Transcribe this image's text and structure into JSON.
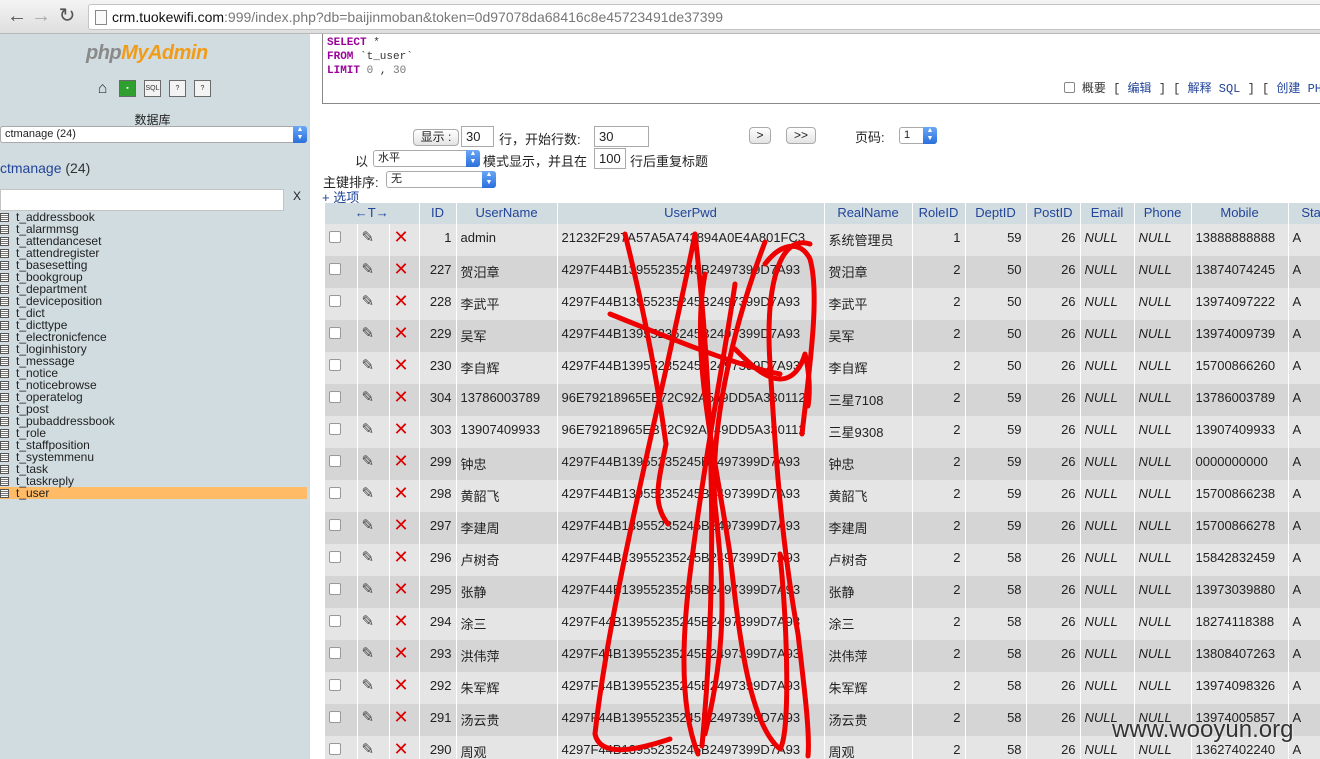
{
  "browser": {
    "url_host": "crm.tuokewifi.com",
    "url_rest": ":999/index.php?db=baijinmoban&token=0d97078da68416c8e45723491de37399"
  },
  "sidebar": {
    "logo_php": "php",
    "logo_myadmin": "MyAdmin",
    "db_label": "数据库",
    "db_select": "ctmanage (24)",
    "db_current": "ctmanage",
    "db_count": "(24)",
    "filter_clear": "X",
    "tables": [
      {
        "name": "t_addressbook"
      },
      {
        "name": "t_alarmmsg"
      },
      {
        "name": "t_attendanceset"
      },
      {
        "name": "t_attendregister"
      },
      {
        "name": "t_basesetting"
      },
      {
        "name": "t_bookgroup"
      },
      {
        "name": "t_department"
      },
      {
        "name": "t_deviceposition"
      },
      {
        "name": "t_dict"
      },
      {
        "name": "t_dicttype"
      },
      {
        "name": "t_electronicfence"
      },
      {
        "name": "t_loginhistory"
      },
      {
        "name": "t_message"
      },
      {
        "name": "t_notice"
      },
      {
        "name": "t_noticebrowse"
      },
      {
        "name": "t_operatelog"
      },
      {
        "name": "t_post"
      },
      {
        "name": "t_pubaddressbook"
      },
      {
        "name": "t_role"
      },
      {
        "name": "t_staffposition"
      },
      {
        "name": "t_systemmenu"
      },
      {
        "name": "t_task"
      },
      {
        "name": "t_taskreply"
      },
      {
        "name": "t_user"
      }
    ],
    "selected_table": "t_user"
  },
  "sql": {
    "select_kw": "SELECT",
    "star": " *",
    "from_kw": "FROM",
    "table": " `t_user`",
    "limit_kw": "LIMIT",
    "limit_a": "0",
    "comma": " , ",
    "limit_b": "30",
    "links_prefix": " 概要 ",
    "link_edit": "编辑",
    "link_explain": "解释 SQL",
    "link_create": "创建 PH"
  },
  "nav": {
    "show_btn": "显示 :",
    "rows_value": "30",
    "rows_label": "行，开始行数:",
    "start_value": "30",
    "next_btn": ">",
    "last_btn": ">>",
    "page_label": "页码:",
    "page_value": "1",
    "mode_prefix": "以",
    "mode_value": "水平",
    "mode_label": "模式显示，并且在",
    "repeat_value": "100",
    "repeat_label": "行后重复标题",
    "sort_label": "主键排序:",
    "sort_value": "无",
    "options_link": "+ 选项"
  },
  "table": {
    "arrows": "←T→",
    "columns": [
      "ID",
      "UserName",
      "UserPwd",
      "RealName",
      "RoleID",
      "DeptID",
      "PostID",
      "Email",
      "Phone",
      "Mobile",
      "State"
    ],
    "rows": [
      {
        "id": "1",
        "username": "admin",
        "pwd": "21232F297A57A5A743894A0E4A801FC3",
        "realname": "系统管理员",
        "roleid": "1",
        "deptid": "59",
        "postid": "26",
        "email": "NULL",
        "phone": "NULL",
        "mobile": "13888888888",
        "state": "A"
      },
      {
        "id": "227",
        "username": "贺汨章",
        "pwd": "4297F44B13955235245B2497399D7A93",
        "realname": "贺汨章",
        "roleid": "2",
        "deptid": "50",
        "postid": "26",
        "email": "NULL",
        "phone": "NULL",
        "mobile": "13874074245",
        "state": "A"
      },
      {
        "id": "228",
        "username": "李武平",
        "pwd": "4297F44B13955235245B2497399D7A93",
        "realname": "李武平",
        "roleid": "2",
        "deptid": "50",
        "postid": "26",
        "email": "NULL",
        "phone": "NULL",
        "mobile": "13974097222",
        "state": "A"
      },
      {
        "id": "229",
        "username": "吴军",
        "pwd": "4297F44B13955235245B2497399D7A93",
        "realname": "吴军",
        "roleid": "2",
        "deptid": "50",
        "postid": "26",
        "email": "NULL",
        "phone": "NULL",
        "mobile": "13974009739",
        "state": "A"
      },
      {
        "id": "230",
        "username": "李自辉",
        "pwd": "4297F44B13955235245B2497399D7A93",
        "realname": "李自辉",
        "roleid": "2",
        "deptid": "50",
        "postid": "26",
        "email": "NULL",
        "phone": "NULL",
        "mobile": "15700866260",
        "state": "A"
      },
      {
        "id": "304",
        "username": "13786003789",
        "pwd": "96E79218965EB72C92A549DD5A330112",
        "realname": "三星7108",
        "roleid": "2",
        "deptid": "59",
        "postid": "26",
        "email": "NULL",
        "phone": "NULL",
        "mobile": "13786003789",
        "state": "A"
      },
      {
        "id": "303",
        "username": "13907409933",
        "pwd": "96E79218965EB72C92A549DD5A330112",
        "realname": "三星9308",
        "roleid": "2",
        "deptid": "59",
        "postid": "26",
        "email": "NULL",
        "phone": "NULL",
        "mobile": "13907409933",
        "state": "A"
      },
      {
        "id": "299",
        "username": "钟忠",
        "pwd": "4297F44B13955235245B2497399D7A93",
        "realname": "钟忠",
        "roleid": "2",
        "deptid": "59",
        "postid": "26",
        "email": "NULL",
        "phone": "NULL",
        "mobile": "0000000000",
        "state": "A"
      },
      {
        "id": "298",
        "username": "黄韶飞",
        "pwd": "4297F44B13955235245B2497399D7A93",
        "realname": "黄韶飞",
        "roleid": "2",
        "deptid": "59",
        "postid": "26",
        "email": "NULL",
        "phone": "NULL",
        "mobile": "15700866238",
        "state": "A"
      },
      {
        "id": "297",
        "username": "李建周",
        "pwd": "4297F44B13955235245B2497399D7A93",
        "realname": "李建周",
        "roleid": "2",
        "deptid": "59",
        "postid": "26",
        "email": "NULL",
        "phone": "NULL",
        "mobile": "15700866278",
        "state": "A"
      },
      {
        "id": "296",
        "username": "卢树奇",
        "pwd": "4297F44B13955235245B2497399D7A93",
        "realname": "卢树奇",
        "roleid": "2",
        "deptid": "58",
        "postid": "26",
        "email": "NULL",
        "phone": "NULL",
        "mobile": "15842832459",
        "state": "A"
      },
      {
        "id": "295",
        "username": "张静",
        "pwd": "4297F44B13955235245B2497399D7A93",
        "realname": "张静",
        "roleid": "2",
        "deptid": "58",
        "postid": "26",
        "email": "NULL",
        "phone": "NULL",
        "mobile": "13973039880",
        "state": "A"
      },
      {
        "id": "294",
        "username": "涂三",
        "pwd": "4297F44B13955235245B2497399D7A93",
        "realname": "涂三",
        "roleid": "2",
        "deptid": "58",
        "postid": "26",
        "email": "NULL",
        "phone": "NULL",
        "mobile": "18274118388",
        "state": "A"
      },
      {
        "id": "293",
        "username": "洪伟萍",
        "pwd": "4297F44B13955235245B2497399D7A93",
        "realname": "洪伟萍",
        "roleid": "2",
        "deptid": "58",
        "postid": "26",
        "email": "NULL",
        "phone": "NULL",
        "mobile": "13808407263",
        "state": "A"
      },
      {
        "id": "292",
        "username": "朱军辉",
        "pwd": "4297F44B13955235245B2497399D7A93",
        "realname": "朱军辉",
        "roleid": "2",
        "deptid": "58",
        "postid": "26",
        "email": "NULL",
        "phone": "NULL",
        "mobile": "13974098326",
        "state": "A"
      },
      {
        "id": "291",
        "username": "汤云贵",
        "pwd": "4297F44B13955235245B2497399D7A93",
        "realname": "汤云贵",
        "roleid": "2",
        "deptid": "58",
        "postid": "26",
        "email": "NULL",
        "phone": "NULL",
        "mobile": "13974005857",
        "state": "A"
      },
      {
        "id": "290",
        "username": "周观",
        "pwd": "4297F44B13955235245B2497399D7A93",
        "realname": "周观",
        "roleid": "2",
        "deptid": "58",
        "postid": "26",
        "email": "NULL",
        "phone": "NULL",
        "mobile": "13627402240",
        "state": "A"
      }
    ]
  },
  "watermark": "www.wooyun.org",
  "colors": {
    "scribble": "#ee0000",
    "sidebar_bg": "#d0dce0",
    "link": "#224499",
    "selected_row": "#ffbb66"
  }
}
